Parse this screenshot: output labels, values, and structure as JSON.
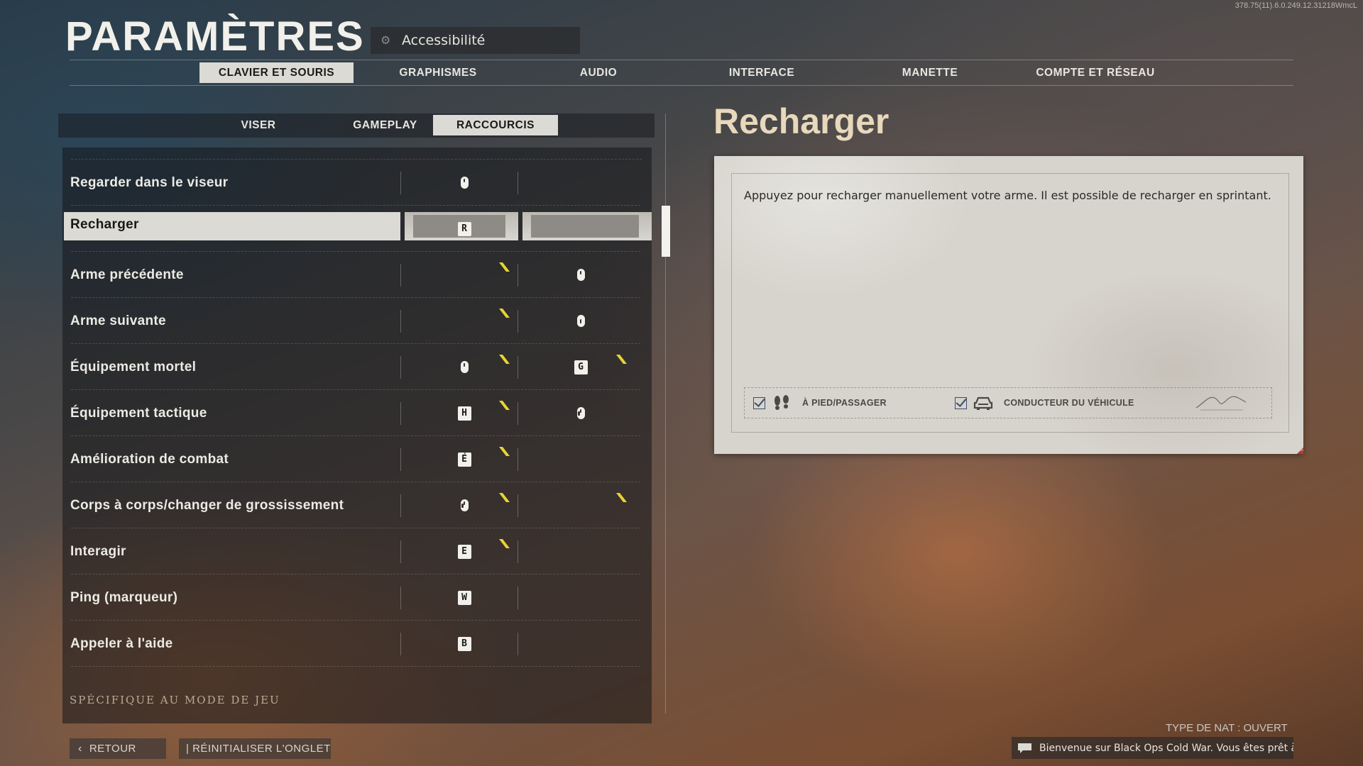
{
  "build_id": "378.75(11).6.0.249.12.31218WmcL",
  "page_title": "PARAMÈTRES",
  "search": {
    "value": "Accessibilité",
    "icon": "gear-icon"
  },
  "top_tabs": [
    {
      "label": "CLAVIER ET SOURIS",
      "active": true
    },
    {
      "label": "GRAPHISMES",
      "active": false
    },
    {
      "label": "AUDIO",
      "active": false
    },
    {
      "label": "INTERFACE",
      "active": false
    },
    {
      "label": "MANETTE",
      "active": false
    },
    {
      "label": "COMPTE ET RÉSEAU",
      "active": false
    }
  ],
  "sub_tabs": [
    {
      "label": "VISER",
      "active": false
    },
    {
      "label": "GAMEPLAY",
      "active": false
    },
    {
      "label": "RACCOURCIS",
      "active": true
    }
  ],
  "bindings": [
    {
      "label": "Regarder dans le viseur",
      "primary": {
        "type": "mouse",
        "icon": "mouse-right-icon"
      },
      "secondary": null,
      "primary_conflict": false,
      "secondary_conflict": false
    },
    {
      "label": "Recharger",
      "selected": true,
      "primary": {
        "type": "key",
        "key": "R"
      },
      "secondary": null,
      "primary_conflict": false,
      "secondary_conflict": false
    },
    {
      "label": "Arme précédente",
      "primary": null,
      "secondary": {
        "type": "mouse",
        "icon": "mouse-wheel-up-icon"
      },
      "primary_conflict": true,
      "secondary_conflict": false
    },
    {
      "label": "Arme suivante",
      "primary": null,
      "secondary": {
        "type": "mouse",
        "icon": "mouse-wheel-down-icon"
      },
      "primary_conflict": true,
      "secondary_conflict": false
    },
    {
      "label": "Équipement mortel",
      "primary": {
        "type": "mouse",
        "icon": "mouse-right-icon"
      },
      "secondary": {
        "type": "key",
        "key": "G"
      },
      "primary_conflict": true,
      "secondary_conflict": true
    },
    {
      "label": "Équipement tactique",
      "primary": {
        "type": "key",
        "key": "H"
      },
      "secondary": {
        "type": "mouse",
        "icon": "mouse-button-5-icon"
      },
      "primary_conflict": true,
      "secondary_conflict": false
    },
    {
      "label": "Amélioration de combat",
      "primary": {
        "type": "key",
        "key": "É"
      },
      "secondary": null,
      "primary_conflict": true,
      "secondary_conflict": false
    },
    {
      "label": "Corps à corps/changer de grossissement",
      "primary": {
        "type": "mouse",
        "icon": "mouse-button-4-icon"
      },
      "secondary": null,
      "primary_conflict": true,
      "secondary_conflict": true
    },
    {
      "label": "Interagir",
      "primary": {
        "type": "key",
        "key": "E"
      },
      "secondary": null,
      "primary_conflict": true,
      "secondary_conflict": false
    },
    {
      "label": "Ping (marqueur)",
      "primary": {
        "type": "key",
        "key": "W"
      },
      "secondary": null,
      "primary_conflict": false,
      "secondary_conflict": false
    },
    {
      "label": "Appeler à l'aide",
      "primary": {
        "type": "key",
        "key": "B"
      },
      "secondary": null,
      "primary_conflict": false,
      "secondary_conflict": false
    }
  ],
  "mode_footer": "SPÉCIFIQUE AU MODE DE JEU",
  "detail": {
    "title": "Recharger",
    "description": "Appuyez pour recharger manuellement votre arme. Il est possible de recharger en sprintant.",
    "tags": [
      {
        "label": "À PIED/PASSAGER",
        "checked": true,
        "icon": "footprints-icon"
      },
      {
        "label": "CONDUCTEUR DU VÉHICULE",
        "checked": true,
        "icon": "vehicle-icon"
      }
    ]
  },
  "buttons": {
    "back": "RETOUR",
    "reset": "| RÉINITIALISER L'ONGLET"
  },
  "nat_status": "TYPE DE NAT : OUVERT",
  "chat_message": "Bienvenue sur Black Ops Cold War. Vous êtes prêt à écr...",
  "colors": {
    "accent_flag": "#e8d432",
    "title_tan": "#e8d8bc",
    "active_tab_bg": "#dcdad4"
  }
}
